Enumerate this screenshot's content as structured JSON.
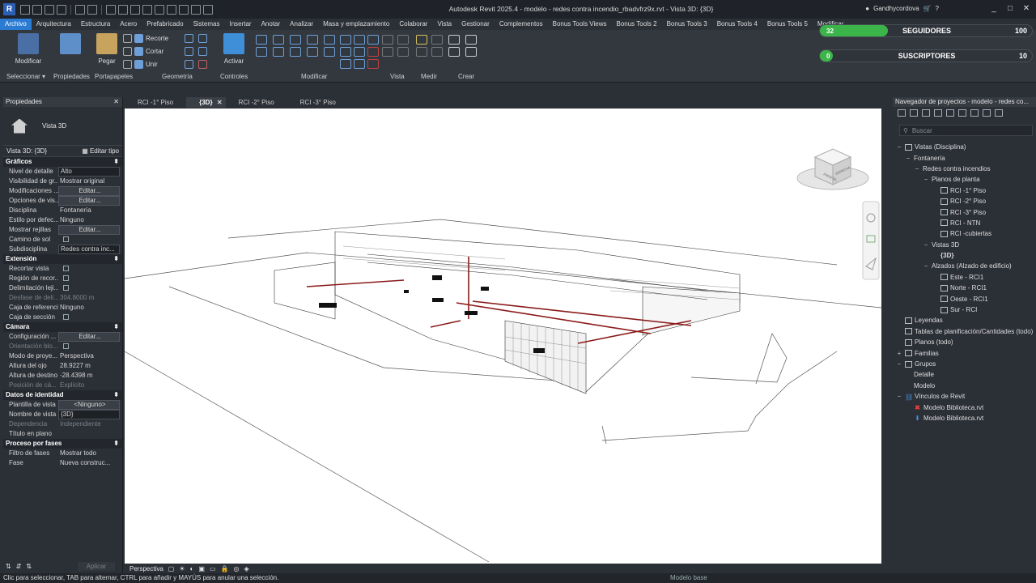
{
  "window": {
    "title": "Autodesk Revit 2025.4 - modelo - redes contra incendio_rbadvfrz9x.rvt - Vista 3D: {3D}",
    "user": "Gandhycordova"
  },
  "ribbon": {
    "tabs": [
      "Archivo",
      "Arquitectura",
      "Estructura",
      "Acero",
      "Prefabricado",
      "Sistemas",
      "Insertar",
      "Anotar",
      "Analizar",
      "Masa y emplazamiento",
      "Colaborar",
      "Vista",
      "Gestionar",
      "Complementos",
      "Bonus Tools Views",
      "Bonus Tools 2",
      "Bonus Tools 3",
      "Bonus Tools 4",
      "Bonus Tools 5",
      "Modificar"
    ],
    "tools": {
      "modificar": "Modificar",
      "pegar": "Pegar",
      "recorte": "Recorte",
      "cortar": "Cortar",
      "unir": "Unir",
      "activar": "Activar"
    },
    "groups": {
      "seleccionar": "Seleccionar ▾",
      "propiedades": "Propiedades",
      "portapapeles": "Portapapeles",
      "geometria": "Geometría",
      "controles": "Controles",
      "modificar": "Modificar",
      "vista": "Vista",
      "medir": "Medir",
      "crear": "Crear"
    }
  },
  "overlay": {
    "seguidores": {
      "label": "SEGUIDORES",
      "value": "100",
      "current": "32",
      "fraction": 0.32
    },
    "suscriptores": {
      "label": "SUSCRIPTORES",
      "value": "10",
      "current": "0",
      "fraction": 0.0
    }
  },
  "properties": {
    "title": "Propiedades",
    "type_name": "Vista 3D",
    "view_selector": "Vista 3D: {3D}",
    "edit_type": "Editar tipo",
    "sections": [
      {
        "name": "Gráficos",
        "rows": [
          {
            "k": "Nivel de detalle",
            "v": "Alto",
            "kind": "field"
          },
          {
            "k": "Visibilidad de gr...",
            "v": "Mostrar original"
          },
          {
            "k": "Modificaciones ...",
            "v": "Editar...",
            "kind": "btn"
          },
          {
            "k": "Opciones de vis...",
            "v": "Editar...",
            "kind": "btn"
          },
          {
            "k": "Disciplina",
            "v": "Fontanería"
          },
          {
            "k": "Estilo por defec...",
            "v": "Ninguno"
          },
          {
            "k": "Mostrar rejillas",
            "v": "Editar...",
            "kind": "btn"
          },
          {
            "k": "Camino de sol",
            "v": "",
            "kind": "cb"
          },
          {
            "k": "Subdisciplina",
            "v": "Redes contra inc...",
            "kind": "field"
          }
        ]
      },
      {
        "name": "Extensión",
        "rows": [
          {
            "k": "Recortar vista",
            "v": "",
            "kind": "cb"
          },
          {
            "k": "Región de recor...",
            "v": "",
            "kind": "cb"
          },
          {
            "k": "Delimitación leji...",
            "v": "",
            "kind": "cb"
          },
          {
            "k": "Desfase de deli...",
            "v": "304.8000 m",
            "dim": true
          },
          {
            "k": "Caja de referencia",
            "v": "Ninguno"
          },
          {
            "k": "Caja de sección",
            "v": "",
            "kind": "cb"
          }
        ]
      },
      {
        "name": "Cámara",
        "rows": [
          {
            "k": "Configuración ...",
            "v": "Editar...",
            "kind": "btn"
          },
          {
            "k": "Orientación blo...",
            "v": "",
            "kind": "cb",
            "dim": true
          },
          {
            "k": "Modo de proye...",
            "v": "Perspectiva"
          },
          {
            "k": "Altura del ojo",
            "v": "28.9227 m"
          },
          {
            "k": "Altura de destino",
            "v": "-28.4398 m"
          },
          {
            "k": "Posición de cá...",
            "v": "Explícito",
            "dim": true
          }
        ]
      },
      {
        "name": "Datos de identidad",
        "rows": [
          {
            "k": "Plantilla de vista",
            "v": "<Ninguno>",
            "kind": "btn"
          },
          {
            "k": "Nombre de vista",
            "v": "{3D}",
            "kind": "field"
          },
          {
            "k": "Dependencia",
            "v": "Independiente",
            "dim": true
          },
          {
            "k": "Título en plano",
            "v": ""
          }
        ]
      },
      {
        "name": "Proceso por fases",
        "rows": [
          {
            "k": "Filtro de fases",
            "v": "Mostrar todo"
          },
          {
            "k": "Fase",
            "v": "Nueva construc..."
          }
        ]
      }
    ],
    "apply": "Aplicar"
  },
  "doc_tabs": [
    {
      "label": "RCI -1° Piso",
      "active": false
    },
    {
      "label": "{3D}",
      "active": true
    },
    {
      "label": "RCI -2° Piso",
      "active": false
    },
    {
      "label": "RCI -3° Piso",
      "active": false
    }
  ],
  "viewport": {
    "projection": "Perspectiva",
    "cube_left": "FRONTAL",
    "cube_right": "DERECHA"
  },
  "browser": {
    "title": "Navegador de proyectos - modelo - redes co...",
    "search_placeholder": "Buscar",
    "tree": [
      {
        "label": "Vistas (Disciplina)",
        "level": 0,
        "toggle": "−",
        "icon": "box"
      },
      {
        "label": "Fontanería",
        "level": 1,
        "toggle": "−"
      },
      {
        "label": "Redes contra incendios",
        "level": 2,
        "toggle": "−"
      },
      {
        "label": "Planos de planta",
        "level": 3,
        "toggle": "−"
      },
      {
        "label": "RCI -1° Piso",
        "level": 4,
        "icon": "box"
      },
      {
        "label": "RCI -2° Piso",
        "level": 4,
        "icon": "box"
      },
      {
        "label": "RCI -3° Piso",
        "level": 4,
        "icon": "box"
      },
      {
        "label": "RCI - NTN",
        "level": 4,
        "icon": "box"
      },
      {
        "label": "RCI -cubiertas",
        "level": 4,
        "icon": "box"
      },
      {
        "label": "Vistas 3D",
        "level": 3,
        "toggle": "−"
      },
      {
        "label": "{3D}",
        "level": 4,
        "bold": true
      },
      {
        "label": "Alzados (Alzado de edificio)",
        "level": 3,
        "toggle": "−"
      },
      {
        "label": "Este - RCI1",
        "level": 4,
        "icon": "box"
      },
      {
        "label": "Norte - RCI1",
        "level": 4,
        "icon": "box"
      },
      {
        "label": "Oeste - RCI1",
        "level": 4,
        "icon": "box"
      },
      {
        "label": "Sur - RCI",
        "level": 4,
        "icon": "box"
      },
      {
        "label": "Leyendas",
        "level": 0,
        "icon": "box"
      },
      {
        "label": "Tablas de planificación/Cantidades (todo)",
        "level": 0,
        "icon": "box"
      },
      {
        "label": "Planos (todo)",
        "level": 0,
        "icon": "box"
      },
      {
        "label": "Familias",
        "level": 0,
        "toggle": "+",
        "icon": "box"
      },
      {
        "label": "Grupos",
        "level": 0,
        "toggle": "−",
        "icon": "box"
      },
      {
        "label": "Detalle",
        "level": 1
      },
      {
        "label": "Modelo",
        "level": 1
      },
      {
        "label": "Vínculos de Revit",
        "level": 0,
        "toggle": "−",
        "icon": "link"
      },
      {
        "label": "Modelo Biblioteca.rvt",
        "level": 1,
        "icon": "x"
      },
      {
        "label": "Modelo Biblioteca.rvt",
        "level": 1,
        "icon": "arrow"
      }
    ]
  },
  "status": {
    "text": "Clic para seleccionar, TAB para alternar, CTRL para añadir y MAYÚS para anular una selección.",
    "model": "Modelo base"
  },
  "colors": {
    "accent": "#2b7bd3",
    "pipe": "#8b1a1a",
    "progress": "#3bb54a"
  }
}
